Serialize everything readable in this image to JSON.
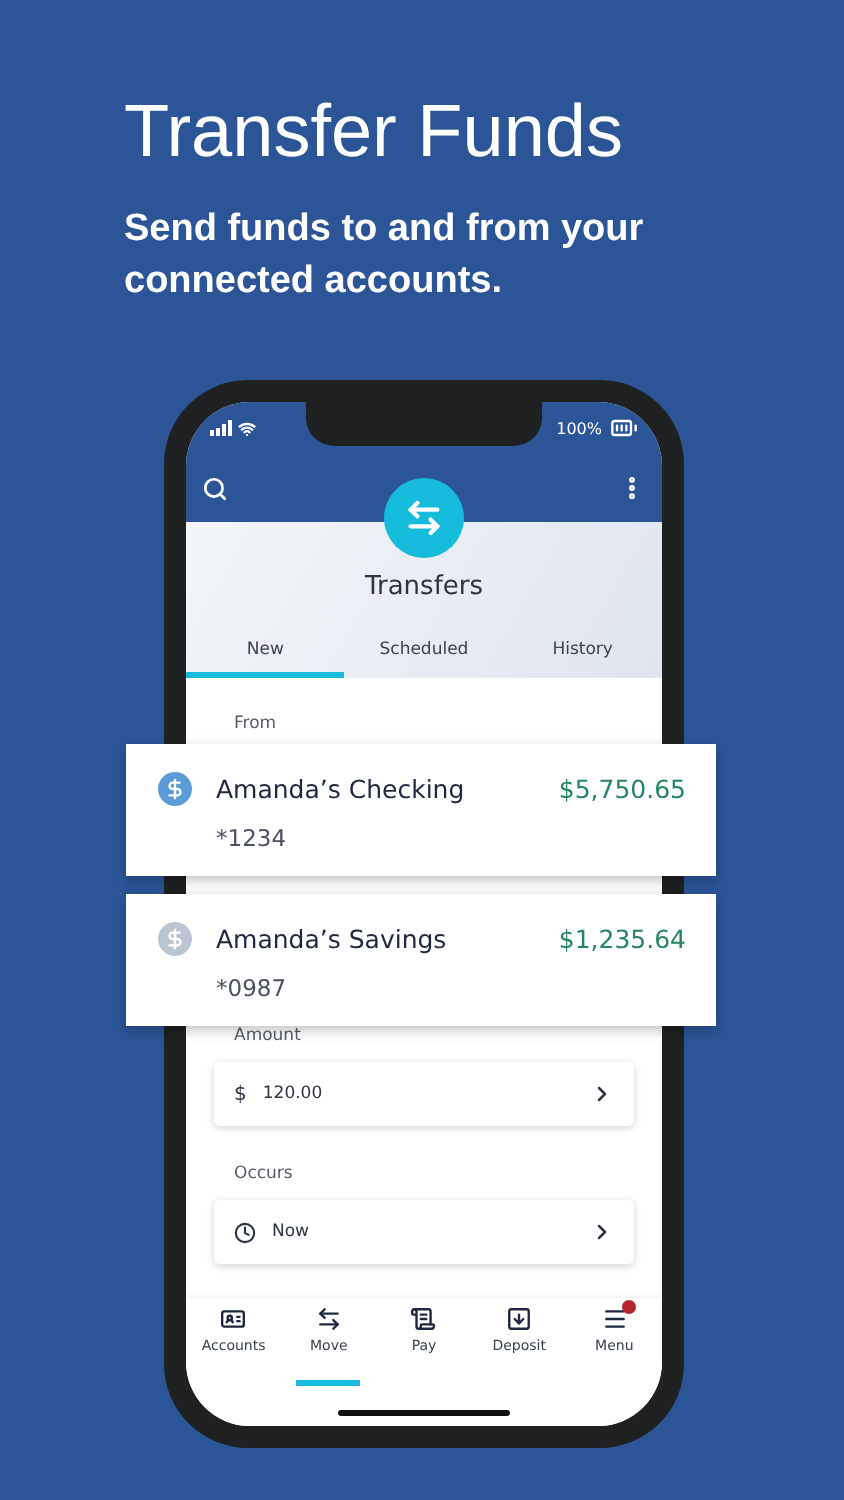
{
  "headline": "Transfer Funds",
  "subtitle": "Send funds to and from your connected accounts.",
  "status_bar": {
    "battery": "100%"
  },
  "screen": {
    "title": "Transfers",
    "tabs": [
      {
        "label": "New",
        "selected": true
      },
      {
        "label": "Scheduled",
        "selected": false
      },
      {
        "label": "History",
        "selected": false
      }
    ],
    "form": {
      "from_label": "From",
      "amount": {
        "label": "Amount",
        "currency": "$",
        "value": "120.00"
      },
      "occurs": {
        "label": "Occurs",
        "value": "Now"
      }
    }
  },
  "accounts": [
    {
      "name": "Amanda’s Checking",
      "number": "*1234",
      "balance": "$5,750.65",
      "color": "#5b9bd8"
    },
    {
      "name": "Amanda’s Savings",
      "number": "*0987",
      "balance": "$1,235.64",
      "color": "#b9c6d2"
    }
  ],
  "nav": [
    {
      "kind": "accounts",
      "label": "Accounts",
      "selected": false,
      "badge": false
    },
    {
      "kind": "move",
      "label": "Move",
      "selected": true,
      "badge": false
    },
    {
      "kind": "pay",
      "label": "Pay",
      "selected": false,
      "badge": false
    },
    {
      "kind": "deposit",
      "label": "Deposit",
      "selected": false,
      "badge": false
    },
    {
      "kind": "menu",
      "label": "Menu",
      "selected": false,
      "badge": true
    }
  ]
}
